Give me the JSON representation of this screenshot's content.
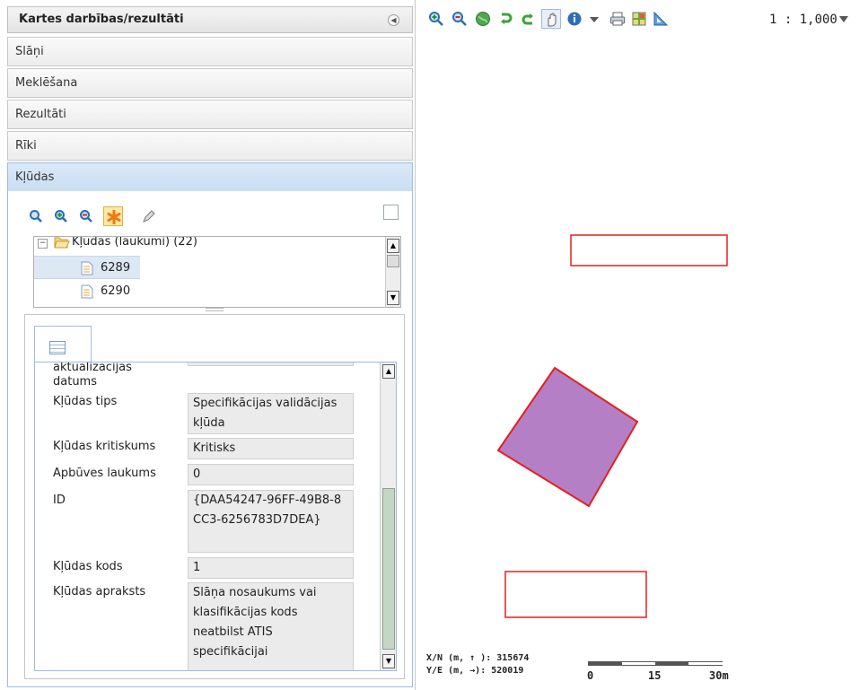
{
  "left_panel": {
    "title": "Kartes darbības/rezultāti",
    "sections": [
      "Slāņi",
      "Meklēšana",
      "Rezultāti",
      "Rīki"
    ],
    "active_section": "Kļūdas",
    "tree": {
      "folder": "Kļūdas (laukumi) (22)",
      "items": [
        "6289",
        "6290"
      ],
      "selected": "6289"
    },
    "attributes": [
      {
        "label": "aktualizācijas datums",
        "value": ""
      },
      {
        "label": "Kļūdas tips",
        "value": "Specifikācijas validācijas kļūda"
      },
      {
        "label": "Kļūdas kritiskums",
        "value": "Kritisks"
      },
      {
        "label": "Apbūves laukums",
        "value": "0"
      },
      {
        "label": "ID",
        "value": "{DAA54247-96FF-49B8-8CC3-6256783D7DEA}"
      },
      {
        "label": "Kļūdas kods",
        "value": "1"
      },
      {
        "label": "Kļūdas apraksts",
        "value": "Slāņa nosaukums vai klasifikācijas kods neatbilst ATIS specifikācijai"
      }
    ]
  },
  "map": {
    "scale": "1 : 1,000",
    "coords": {
      "x_label": "X/N (m, ↑ ): 315674",
      "y_label": "Y/E (m, →): 520019"
    },
    "scalebar_ticks": [
      "0",
      "15",
      "30m"
    ],
    "colors": {
      "outline": "#e32020",
      "fill": "#b57fc6"
    }
  }
}
